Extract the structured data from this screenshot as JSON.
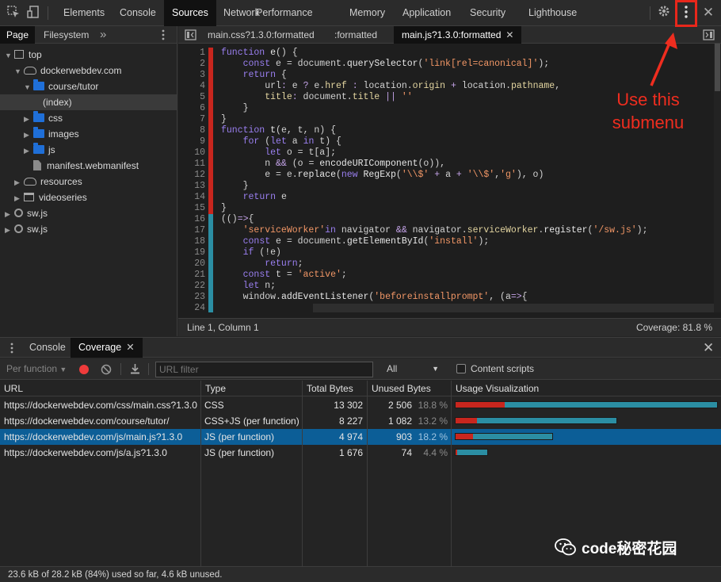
{
  "toolbar": {
    "tabs": [
      "Elements",
      "Console",
      "Sources",
      "Network",
      "Performance",
      "Memory",
      "Application",
      "Security",
      "Lighthouse"
    ],
    "active_tab": "Sources"
  },
  "navigator": {
    "tabs": [
      "Page",
      "Filesystem"
    ],
    "tree": [
      {
        "label": "top",
        "kind": "frame-top"
      },
      {
        "label": "dockerwebdev.com",
        "kind": "domain"
      },
      {
        "label": "course/tutor",
        "kind": "folder"
      },
      {
        "label": "(index)",
        "kind": "file"
      },
      {
        "label": "css",
        "kind": "folder"
      },
      {
        "label": "images",
        "kind": "folder"
      },
      {
        "label": "js",
        "kind": "folder"
      },
      {
        "label": "manifest.webmanifest",
        "kind": "file"
      },
      {
        "label": "resources",
        "kind": "domain"
      },
      {
        "label": "videoseries",
        "kind": "frame"
      },
      {
        "label": "sw.js",
        "kind": "worker"
      },
      {
        "label": "sw.js",
        "kind": "worker"
      }
    ]
  },
  "editor": {
    "tabs": [
      "main.css?1.3.0:formatted",
      ":formatted",
      "main.js?1.3.0:formatted"
    ],
    "code": [
      "function e() {",
      "    const e = document.querySelector('link[rel=canonical]');",
      "    return {",
      "        url: e ? e.href : location.origin + location.pathname,",
      "        title: document.title || ''",
      "    }",
      "}",
      "function t(e, t, n) {",
      "    for (let a in t) {",
      "        let o = t[a];",
      "        n && (o = encodeURIComponent(o)),",
      "        e = e.replace(new RegExp('\\\\$' + a + '\\\\$','g'), o)",
      "    }",
      "    return e",
      "}",
      "(()=>{",
      "    'serviceWorker'in navigator && navigator.serviceWorker.register('/sw.js');",
      "    const e = document.getElementById('install');",
      "    if (!e)",
      "        return;",
      "    const t = 'active';",
      "    let n;",
      "    window.addEventListener('beforeinstallprompt', (a=>{",
      ""
    ],
    "coverage_lines": [
      "u",
      "u",
      "u",
      "u",
      "u",
      "u",
      "u",
      "u",
      "u",
      "u",
      "u",
      "u",
      "u",
      "u",
      "u",
      "c",
      "c",
      "c",
      "c",
      "c",
      "c",
      "c",
      "c",
      "c"
    ],
    "cursor": "Line 1, Column 1",
    "coverage": "Coverage: 81.8 %"
  },
  "drawer": {
    "tabs": [
      "Console",
      "Coverage"
    ],
    "per_function": "Per function",
    "url_filter_placeholder": "URL filter",
    "type_filter": "All",
    "content_scripts": "Content scripts",
    "columns": [
      "URL",
      "Type",
      "Total Bytes",
      "Unused Bytes",
      "Usage Visualization"
    ],
    "rows": [
      {
        "url": "https://dockerwebdev.com/css/main.css?1.3.0",
        "type": "CSS",
        "total": "13 302",
        "unused": "2 506",
        "pct": "18.8 %",
        "unused_frac": 0.188,
        "total_bytes": 13302
      },
      {
        "url": "https://dockerwebdev.com/course/tutor/",
        "type": "CSS+JS (per function)",
        "total": "8 227",
        "unused": "1 082",
        "pct": "13.2 %",
        "unused_frac": 0.132,
        "total_bytes": 8227
      },
      {
        "url": "https://dockerwebdev.com/js/main.js?1.3.0",
        "type": "JS (per function)",
        "total": "4 974",
        "unused": "903",
        "pct": "18.2 %",
        "unused_frac": 0.182,
        "total_bytes": 4974
      },
      {
        "url": "https://dockerwebdev.com/js/a.js?1.3.0",
        "type": "JS (per function)",
        "total": "1 676",
        "unused": "74",
        "pct": "4.4 %",
        "unused_frac": 0.044,
        "total_bytes": 1676
      }
    ],
    "selected_row": 2,
    "status": "23.6 kB of 28.2 kB (84%) used so far, 4.6 kB unused."
  },
  "annotation": {
    "text_line1": "Use this",
    "text_line2": "submenu"
  },
  "watermark": "code秘密花园",
  "colors": {
    "unused": "#c8261e",
    "covered": "#2b8ea3",
    "annotation": "#e8271b",
    "selection": "#0c5e97"
  }
}
